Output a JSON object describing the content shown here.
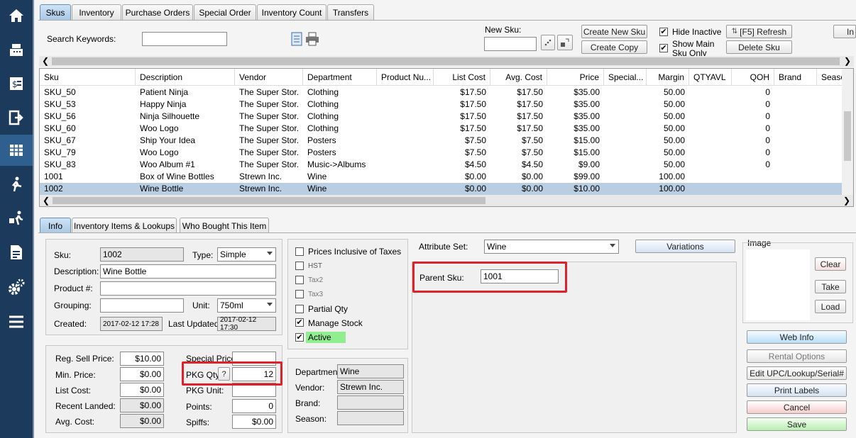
{
  "tabs_top": [
    "Skus",
    "Inventory",
    "Purchase Orders",
    "Special Order",
    "Inventory Count",
    "Transfers"
  ],
  "search": {
    "label": "Search Keywords:",
    "value": ""
  },
  "new_sku": {
    "label": "New Sku:",
    "value": ""
  },
  "buttons": {
    "create_new": "Create New Sku",
    "create_copy": "Create Copy",
    "refresh": "[F5] Refresh",
    "delete": "Delete Sku",
    "far_right": "In"
  },
  "checks": {
    "hide_inactive": "Hide Inactive",
    "show_main": "Show Main Sku Only"
  },
  "grid": {
    "columns": [
      "Sku",
      "Description",
      "Vendor",
      "Department",
      "Product Nu...",
      "List Cost",
      "Avg. Cost",
      "Price",
      "Special...",
      "Margin",
      "QTYAVL",
      "QOH",
      "Brand",
      "Season"
    ],
    "rows": [
      [
        "SKU_50",
        "Patient Ninja",
        "The Super Stor...",
        "Clothing",
        "",
        "$17.50",
        "$17.50",
        "$35.00",
        "",
        "50.00",
        "",
        "0",
        "",
        ""
      ],
      [
        "SKU_53",
        "Happy Ninja",
        "The Super Stor...",
        "Clothing",
        "",
        "$17.50",
        "$17.50",
        "$35.00",
        "",
        "50.00",
        "",
        "0",
        "",
        ""
      ],
      [
        "SKU_56",
        "Ninja Silhouette",
        "The Super Stor...",
        "Clothing",
        "",
        "$17.50",
        "$17.50",
        "$35.00",
        "",
        "50.00",
        "",
        "0",
        "",
        ""
      ],
      [
        "SKU_60",
        "Woo Logo",
        "The Super Stor...",
        "Clothing",
        "",
        "$17.50",
        "$17.50",
        "$35.00",
        "",
        "50.00",
        "",
        "0",
        "",
        ""
      ],
      [
        "SKU_67",
        "Ship Your Idea",
        "The Super Stor...",
        "Posters",
        "",
        "$7.50",
        "$7.50",
        "$15.00",
        "",
        "50.00",
        "",
        "0",
        "",
        ""
      ],
      [
        "SKU_79",
        "Woo Logo",
        "The Super Stor...",
        "Posters",
        "",
        "$7.50",
        "$7.50",
        "$15.00",
        "",
        "50.00",
        "",
        "0",
        "",
        ""
      ],
      [
        "SKU_83",
        "Woo Album #1",
        "The Super Stor...",
        "Music->Albums",
        "",
        "$4.50",
        "$4.50",
        "$9.00",
        "",
        "50.00",
        "",
        "0",
        "",
        ""
      ],
      [
        "1001",
        "Box of Wine Bottles",
        "Strewn Inc.",
        "Wine",
        "",
        "$0.00",
        "$0.00",
        "$99.00",
        "",
        "100.00",
        "",
        "",
        "",
        ""
      ],
      [
        "1002",
        "Wine Bottle",
        "Strewn Inc.",
        "Wine",
        "",
        "$0.00",
        "$0.00",
        "$10.00",
        "",
        "100.00",
        "",
        "",
        "",
        ""
      ]
    ]
  },
  "tabs_bottom": [
    "Info",
    "Inventory Items & Lookups",
    "Who Bought This Item"
  ],
  "info": {
    "sku_label": "Sku:",
    "sku": "1002",
    "type_label": "Type:",
    "type": "Simple",
    "desc_label": "Description:",
    "desc": "Wine Bottle",
    "product_label": "Product #:",
    "product": "",
    "grouping_label": "Grouping:",
    "grouping": "",
    "unit_label": "Unit:",
    "unit": "750ml",
    "created_label": "Created:",
    "created": "2017-02-12 17:28",
    "updated_label": "Last Updated:",
    "updated": "2017-02-12 17:30"
  },
  "price": {
    "reg_label": "Reg. Sell Price:",
    "reg": "$10.00",
    "min_label": "Min. Price:",
    "min": "$0.00",
    "list_label": "List Cost:",
    "list": "$0.00",
    "recent_label": "Recent Landed:",
    "recent": "$0.00",
    "avg_label": "Avg. Cost:",
    "avg": "$0.00",
    "special_label": "Special Price:",
    "special": "",
    "pkgqty_label": "PKG Qty:",
    "pkgqty_help": "?",
    "pkgqty": "12",
    "pkgunit_label": "PKG Unit:",
    "pkgunit": "",
    "points_label": "Points:",
    "points": "0",
    "spiffs_label": "Spiffs:",
    "spiffs": "$0.00"
  },
  "flags": {
    "prices_incl": "Prices Inclusive of Taxes",
    "hst": "HST",
    "tax2": "Tax2",
    "tax3": "Tax3",
    "partial": "Partial Qty",
    "manage": "Manage Stock",
    "active": "Active"
  },
  "dept": {
    "dept_label": "Department:",
    "dept": "Wine",
    "vendor_label": "Vendor:",
    "vendor": "Strewn Inc.",
    "brand_label": "Brand:",
    "brand": "",
    "season_label": "Season:",
    "season": ""
  },
  "attr": {
    "label": "Attribute Set:",
    "value": "Wine",
    "variations": "Variations",
    "parent_label": "Parent Sku:",
    "parent": "1001"
  },
  "image": {
    "label": "Image",
    "clear": "Clear",
    "take": "Take",
    "load": "Load"
  },
  "actions": {
    "web": "Web Info",
    "rental": "Rental Options",
    "edit_upc": "Edit UPC/Lookup/Serial#",
    "print": "Print Labels",
    "cancel": "Cancel",
    "save": "Save"
  },
  "colors": {
    "sidebar": "#1c3a5c",
    "highlight": "#e0202a",
    "active": "#90ee90",
    "save": "#c8f0c0",
    "cancel": "#f8d0d0",
    "web": "#c8e4f8"
  }
}
